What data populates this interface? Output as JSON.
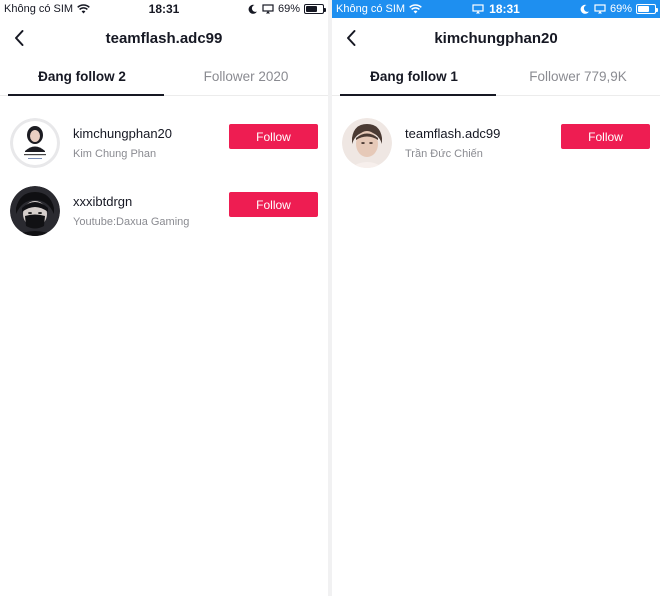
{
  "left": {
    "status": {
      "carrier": "Không có SIM",
      "time": "18:31",
      "battery": "69%",
      "battery_level": 0.69
    },
    "header": {
      "title": "teamflash.adc99"
    },
    "tabs": [
      {
        "label": "Đang follow 2",
        "active": true
      },
      {
        "label": "Follower 2020",
        "active": false
      }
    ],
    "users": [
      {
        "username": "kimchungphan20",
        "nickname": "Kim Chung Phan",
        "button": "Follow"
      },
      {
        "username": "xxxibtdrgn",
        "nickname": "Youtube:Daxua Gaming",
        "button": "Follow"
      }
    ]
  },
  "right": {
    "status": {
      "carrier": "Không có SIM",
      "time": "18:31",
      "battery": "69%",
      "battery_level": 0.69
    },
    "header": {
      "title": "kimchungphan20"
    },
    "tabs": [
      {
        "label": "Đang follow 1",
        "active": true
      },
      {
        "label": "Follower 779,9K",
        "active": false
      }
    ],
    "users": [
      {
        "username": "teamflash.adc99",
        "nickname": "Trần Đức Chiến",
        "button": "Follow"
      }
    ]
  },
  "colors": {
    "follow_button": "#ee1d52",
    "status_bar_right": "#1e8ff0",
    "text_primary": "#161823",
    "text_secondary": "#8a8b91"
  }
}
